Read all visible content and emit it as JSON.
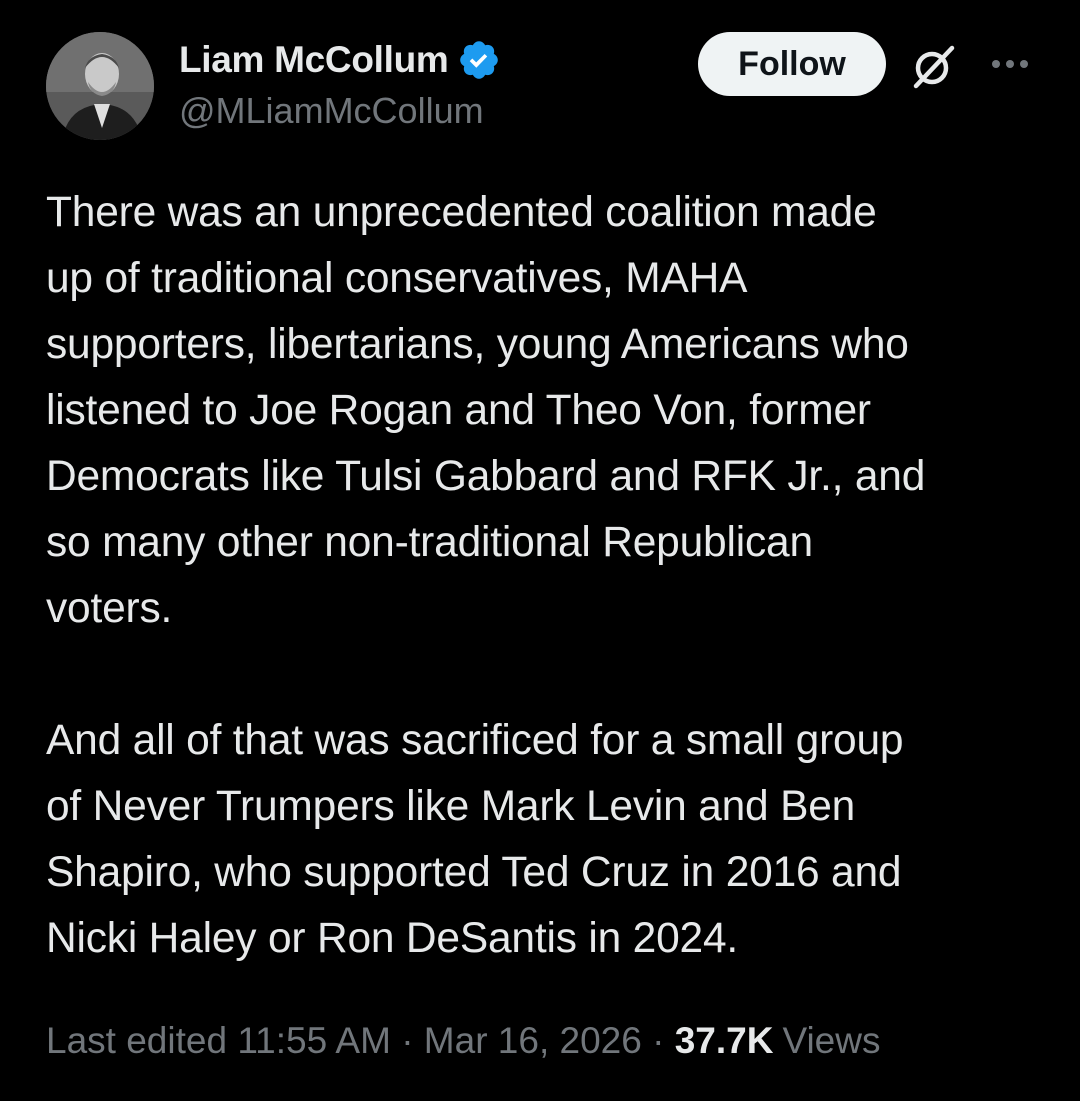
{
  "author": {
    "display_name": "Liam McCollum",
    "handle": "@MLiamMcCollum",
    "verified": true
  },
  "header": {
    "follow_label": "Follow",
    "grok_icon": "grok-icon",
    "more_icon": "more-icon"
  },
  "post": {
    "paragraph_1": "There was an unprecedented coalition made\nup of traditional conservatives, MAHA\nsupporters, libertarians, young Americans who\nlistened to Joe Rogan and Theo Von, former\nDemocrats like Tulsi Gabbard and RFK Jr., and\nso many other non-traditional Republican\nvoters.",
    "paragraph_2": "And all of that was sacrificed for a small group\nof Never Trumpers like Mark Levin and Ben\nShapiro, who supported Ted Cruz in 2016 and\nNicki Haley or Ron DeSantis in 2024."
  },
  "meta": {
    "edited_label": "Last edited",
    "time": "11:55 AM",
    "date": "Mar 16, 2026",
    "separator": "·",
    "views_count": "37.7K",
    "views_label": "Views"
  },
  "colors": {
    "background": "#000000",
    "text_primary": "#e7e9ea",
    "text_secondary": "#71767b",
    "verified_blue": "#1d9bf0",
    "follow_bg": "#eff3f4"
  }
}
